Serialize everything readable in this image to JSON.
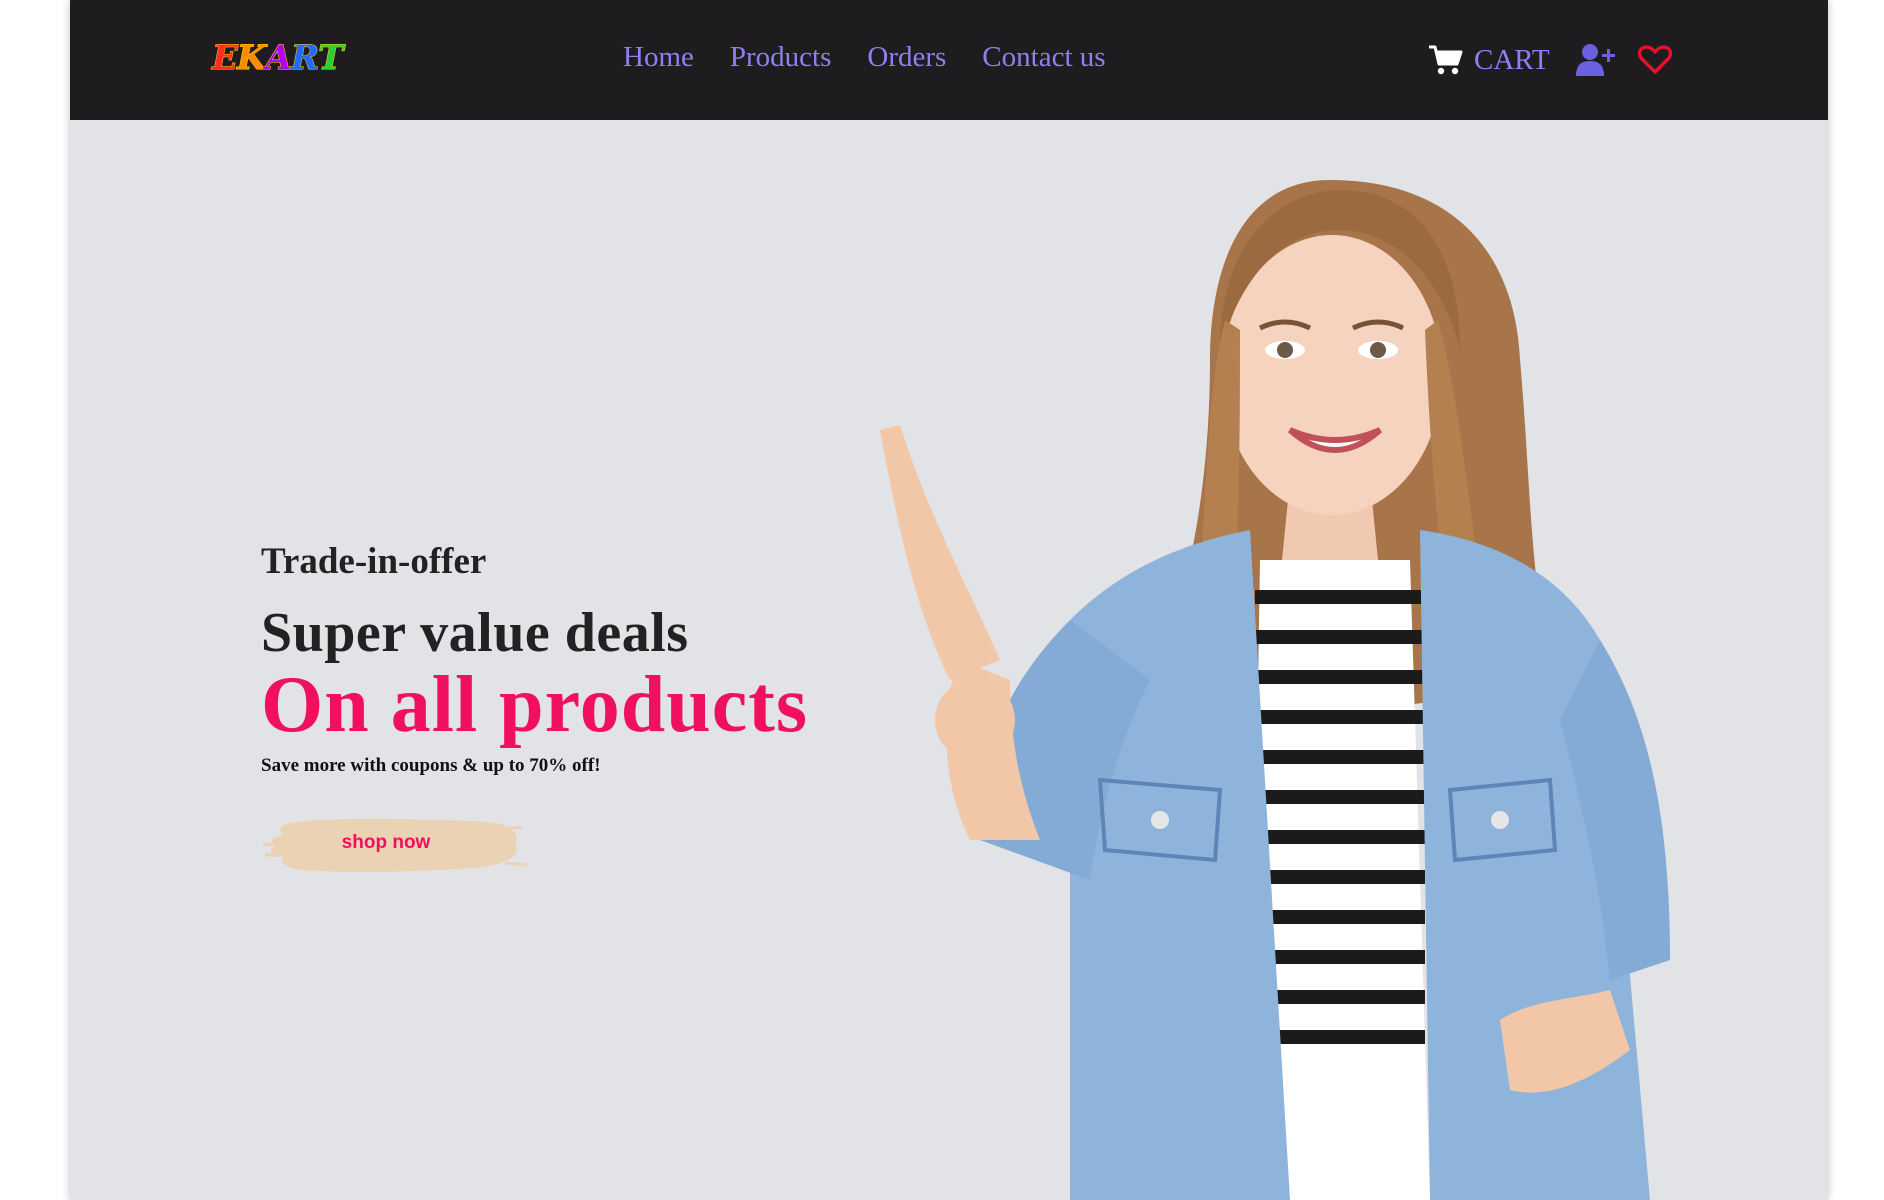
{
  "brand": {
    "logo_letters": [
      "E",
      "K",
      "A",
      "R",
      "T"
    ],
    "logo_colors": [
      "#ff2a2a",
      "#ff8a00",
      "#b000ff",
      "#1e6bff",
      "#2ecc40"
    ]
  },
  "nav": {
    "links": [
      "Home",
      "Products",
      "Orders",
      "Contact us"
    ],
    "link_color": "#8a82f0",
    "cart_label": "CART",
    "icons": [
      "cart-icon",
      "user-plus-icon",
      "heart-icon"
    ]
  },
  "hero": {
    "eyebrow": "Trade-in-offer",
    "headline": "Super value deals",
    "highlight": "On all products",
    "subtext": "Save more with coupons & up to 70% off!",
    "cta_label": "shop now",
    "accent_color": "#f0105d",
    "cta_bg_color": "#ebd2b4",
    "background_color": "#e2e3e6",
    "image": "smiling woman in denim jacket pointing up"
  }
}
